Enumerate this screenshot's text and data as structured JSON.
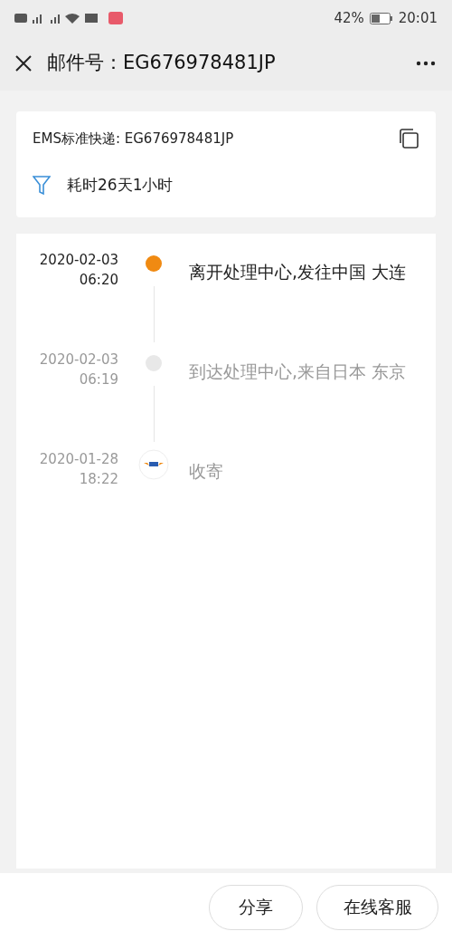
{
  "status_bar": {
    "battery_text": "42%",
    "time": "20:01"
  },
  "header": {
    "title": "邮件号：EG676978481JP"
  },
  "summary": {
    "tracking": "EMS标准快递: EG676978481JP",
    "duration": "耗时26天1小时"
  },
  "timeline": [
    {
      "kind": "current",
      "date": "2020-02-03",
      "time": "06:20",
      "text": "离开处理中心,发往中国 大连"
    },
    {
      "kind": "past",
      "date": "2020-02-03",
      "time": "06:19",
      "text": "到达处理中心,来自日本 东京"
    },
    {
      "kind": "origin",
      "date": "2020-01-28",
      "time": "18:22",
      "text": "收寄"
    }
  ],
  "buttons": [
    "分享",
    "在线客服"
  ]
}
